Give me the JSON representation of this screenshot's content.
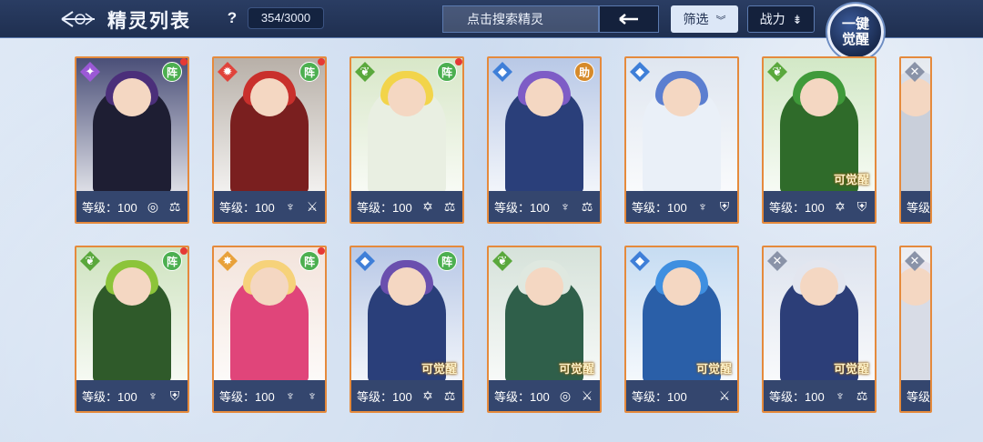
{
  "header": {
    "title": "精灵列表",
    "help": "?",
    "count": "354/3000",
    "search_placeholder": "点击搜索精灵",
    "filter_label": "筛选",
    "power_label": "战力",
    "awaken_line1": "一键",
    "awaken_line2": "觉醒"
  },
  "cards": [
    {
      "level": "等级：100",
      "badge": "阵",
      "badgeColor": "#4caf50",
      "redDot": true,
      "element": "✦",
      "elementColor": "#9b59d6",
      "awakenable": "",
      "icons": [
        "◎",
        "⚖"
      ],
      "hair": "#4b2f7a",
      "outfit": "#1e1e33",
      "bg": "#4a4f78"
    },
    {
      "level": "等级：100",
      "badge": "阵",
      "badgeColor": "#4caf50",
      "redDot": true,
      "element": "✹",
      "elementColor": "#e0433b",
      "awakenable": "",
      "icons": [
        "♆",
        "⚔"
      ],
      "hair": "#c9302c",
      "outfit": "#7a1f1f",
      "bg": "#b8b0a8"
    },
    {
      "level": "等级：100",
      "badge": "阵",
      "badgeColor": "#4caf50",
      "redDot": true,
      "element": "❦",
      "elementColor": "#5aa83c",
      "awakenable": "",
      "icons": [
        "✡",
        "⚖"
      ],
      "hair": "#f2d44a",
      "outfit": "#e9efe2",
      "bg": "#d8e7c8"
    },
    {
      "level": "等级：100",
      "badge": "助",
      "badgeColor": "#d68a2a",
      "redDot": false,
      "element": "◆",
      "elementColor": "#3f7fd8",
      "awakenable": "",
      "icons": [
        "♆",
        "⚖"
      ],
      "hair": "#7e5cc6",
      "outfit": "#2a3f7a",
      "bg": "#b8c8e6"
    },
    {
      "level": "等级：100",
      "badge": "",
      "badgeColor": "",
      "redDot": false,
      "element": "◆",
      "elementColor": "#3f7fd8",
      "awakenable": "",
      "icons": [
        "♆",
        "⛨"
      ],
      "hair": "#5b7ed0",
      "outfit": "#eaf0f8",
      "bg": "#dfe6f0"
    },
    {
      "level": "等级：100",
      "badge": "",
      "badgeColor": "",
      "redDot": false,
      "element": "❦",
      "elementColor": "#5aa83c",
      "awakenable": "可觉醒",
      "icons": [
        "✡",
        "⛨"
      ],
      "hair": "#3f9a3a",
      "outfit": "#2f6b2a",
      "bg": "#d2e8c6"
    },
    {
      "level": "等级",
      "badge": "",
      "badgeColor": "",
      "redDot": false,
      "element": "✕",
      "elementColor": "#8a93a8",
      "awakenable": "",
      "icons": [],
      "hair": "#d7dde8",
      "outfit": "#c9cfda",
      "bg": "#e6eaf0"
    },
    {
      "level": "等级：100",
      "badge": "阵",
      "badgeColor": "#4caf50",
      "redDot": true,
      "element": "❦",
      "elementColor": "#5aa83c",
      "awakenable": "",
      "icons": [
        "♆",
        "⛨"
      ],
      "hair": "#8cc43a",
      "outfit": "#2f5a2a",
      "bg": "#cfe3c0"
    },
    {
      "level": "等级：100",
      "badge": "阵",
      "badgeColor": "#4caf50",
      "redDot": true,
      "element": "✸",
      "elementColor": "#e8a13a",
      "awakenable": "",
      "icons": [
        "♆",
        "♆"
      ],
      "hair": "#f6d27a",
      "outfit": "#e0457a",
      "bg": "#f3e4dc"
    },
    {
      "level": "等级：100",
      "badge": "阵",
      "badgeColor": "#4caf50",
      "redDot": false,
      "element": "◆",
      "elementColor": "#3f7fd8",
      "awakenable": "可觉醒",
      "icons": [
        "✡",
        "⚖"
      ],
      "hair": "#6a4fae",
      "outfit": "#2a3f7a",
      "bg": "#b8c8e6"
    },
    {
      "level": "等级：100",
      "badge": "",
      "badgeColor": "",
      "redDot": false,
      "element": "❦",
      "elementColor": "#5aa83c",
      "awakenable": "可觉醒",
      "icons": [
        "◎",
        "⚔"
      ],
      "hair": "#dfe8e0",
      "outfit": "#2f5f4a",
      "bg": "#d6e2da"
    },
    {
      "level": "等级：100",
      "badge": "",
      "badgeColor": "",
      "redDot": false,
      "element": "◆",
      "elementColor": "#3f7fd8",
      "awakenable": "可觉醒",
      "icons": [
        "⚔"
      ],
      "hair": "#3f8fe0",
      "outfit": "#2a5fa8",
      "bg": "#c6dcf2"
    },
    {
      "level": "等级：100",
      "badge": "",
      "badgeColor": "",
      "redDot": false,
      "element": "✕",
      "elementColor": "#8a93a8",
      "awakenable": "可觉醒",
      "icons": [
        "♆",
        "⚖"
      ],
      "hair": "#e3e6ef",
      "outfit": "#2c3e78",
      "bg": "#dde3ee"
    },
    {
      "level": "等级",
      "badge": "",
      "badgeColor": "",
      "redDot": false,
      "element": "✕",
      "elementColor": "#8a93a8",
      "awakenable": "",
      "icons": [],
      "hair": "#e6e2ea",
      "outfit": "#d8dce6",
      "bg": "#eceef3"
    }
  ]
}
